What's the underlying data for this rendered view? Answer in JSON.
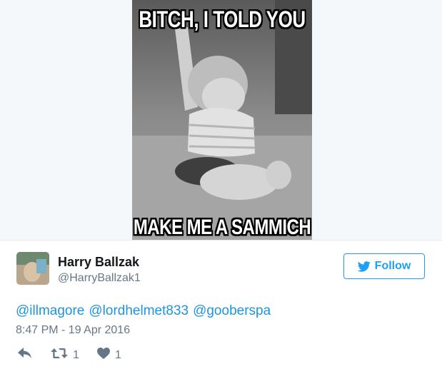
{
  "media": {
    "top_text": "BITCH, I TOLD YOU",
    "bottom_text": "MAKE ME A SAMMICH"
  },
  "user": {
    "name": "Harry Ballzak",
    "handle": "@HarryBallzak1"
  },
  "follow_button": {
    "label": "Follow"
  },
  "tweet": {
    "mentions": [
      "@illmagore",
      "@lordhelmet833",
      "@gooberspa"
    ],
    "timestamp": "8:47 PM - 19 Apr 2016"
  },
  "actions": {
    "retweet_count": "1",
    "like_count": "1"
  },
  "colors": {
    "accent": "#1da1f2",
    "link": "#1b95e0",
    "muted": "#657786"
  },
  "icons": {
    "reply": "reply-icon",
    "retweet": "retweet-icon",
    "like": "heart-icon",
    "follow": "twitter-bird-icon"
  }
}
